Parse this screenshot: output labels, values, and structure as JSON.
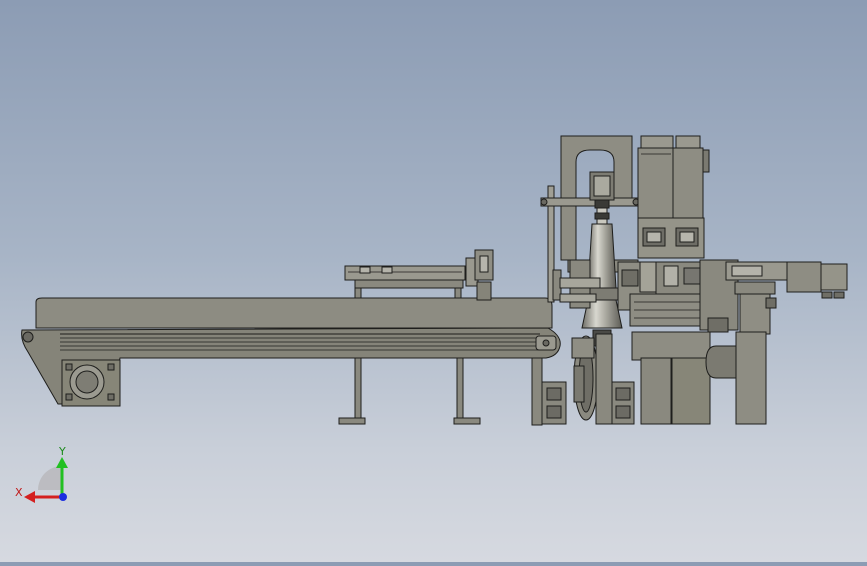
{
  "view": {
    "background_top": "#8c9cb4",
    "background_bottom": "#d6d9e0",
    "model_fill": "#8a897f",
    "model_fill_light": "#a3a298",
    "model_stroke": "#1e1e1c"
  },
  "triad": {
    "x_label": "X",
    "y_label": "Y",
    "x_color": "#d42020",
    "y_color": "#22c022",
    "z_color": "#1c2ee0"
  }
}
